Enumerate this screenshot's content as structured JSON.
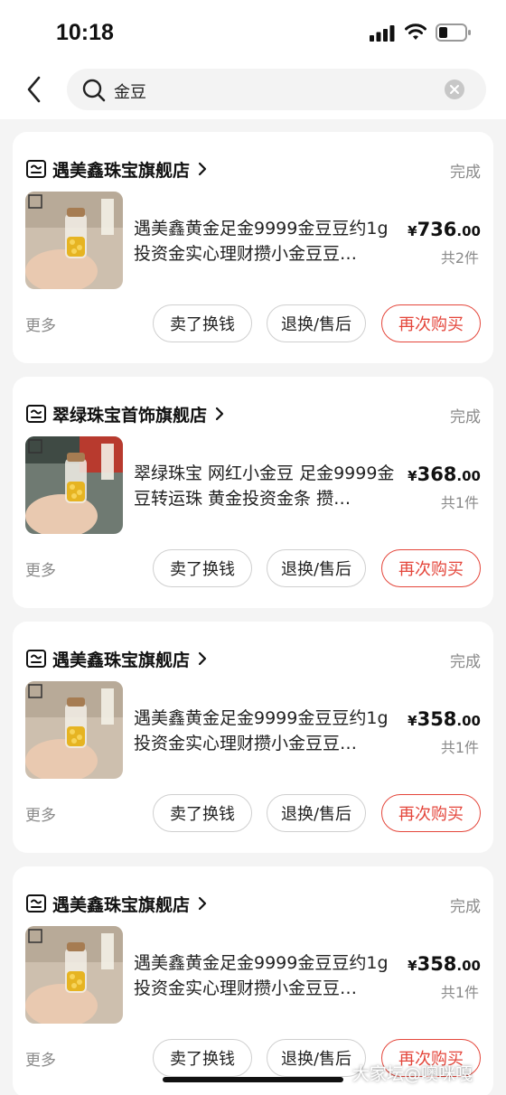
{
  "status_bar": {
    "time": "10:18"
  },
  "search": {
    "query": "金豆"
  },
  "orders": [
    {
      "store": "遇美鑫珠宝旗舰店",
      "status": "完成",
      "title": "遇美鑫黄金足金9999金豆豆约1g投资金实心理财攒小金豆豆…",
      "price_symbol": "¥",
      "price_int": "736",
      "price_dec": ".00",
      "qty": "共2件",
      "more": "更多",
      "btn_sell": "卖了换钱",
      "btn_refund": "退换/售后",
      "btn_rebuy": "再次购买",
      "thumb_style": "bottle"
    },
    {
      "store": "翠绿珠宝首饰旗舰店",
      "status": "完成",
      "title": "翠绿珠宝 网红小金豆 足金9999金豆转运珠 黄金投资金条 攒…",
      "price_symbol": "¥",
      "price_int": "368",
      "price_dec": ".00",
      "qty": "共1件",
      "more": "更多",
      "btn_sell": "卖了换钱",
      "btn_refund": "退换/售后",
      "btn_rebuy": "再次购买",
      "thumb_style": "bottle-dark"
    },
    {
      "store": "遇美鑫珠宝旗舰店",
      "status": "完成",
      "title": "遇美鑫黄金足金9999金豆豆约1g投资金实心理财攒小金豆豆…",
      "price_symbol": "¥",
      "price_int": "358",
      "price_dec": ".00",
      "qty": "共1件",
      "more": "更多",
      "btn_sell": "卖了换钱",
      "btn_refund": "退换/售后",
      "btn_rebuy": "再次购买",
      "thumb_style": "bottle"
    },
    {
      "store": "遇美鑫珠宝旗舰店",
      "status": "完成",
      "title": "遇美鑫黄金足金9999金豆豆约1g投资金实心理财攒小金豆豆…",
      "price_symbol": "¥",
      "price_int": "358",
      "price_dec": ".00",
      "qty": "共1件",
      "more": "更多",
      "btn_sell": "卖了换钱",
      "btn_refund": "退换/售后",
      "btn_rebuy": "再次购买",
      "thumb_style": "bottle"
    }
  ],
  "watermark": "大家坛@噢咪嘎",
  "colors": {
    "accent": "#e4463b",
    "muted": "#8a8a8a",
    "background": "#f4f4f4"
  },
  "icons": {
    "back": "chevron-left-icon",
    "search": "search-icon",
    "clear": "clear-icon",
    "store": "store-icon",
    "store_chevron": "chevron-right-icon"
  }
}
